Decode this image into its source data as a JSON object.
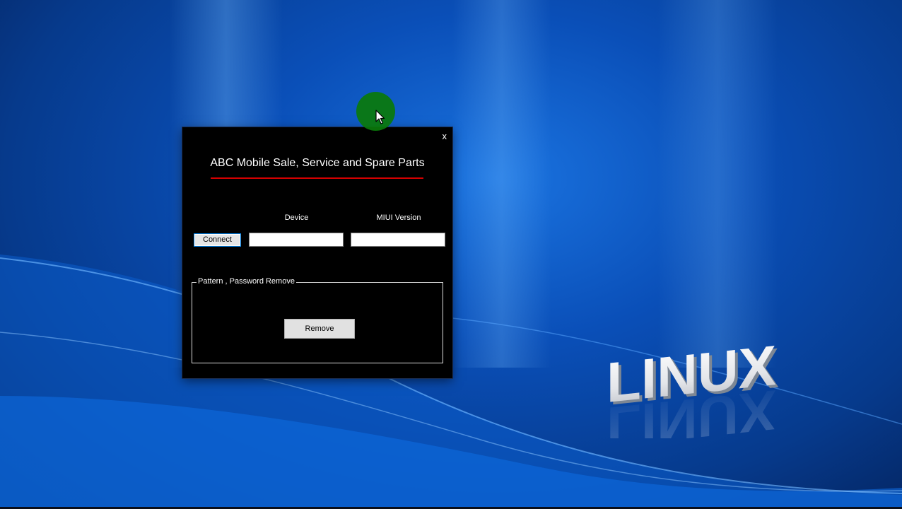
{
  "desktop": {
    "logo_text": "LINUX",
    "background_color": "#0a4fb8"
  },
  "dialog": {
    "title": "ABC Mobile Sale, Service and Spare Parts",
    "close_label": "x",
    "accent_underline_color": "#d40000",
    "columns": {
      "device_label": "Device",
      "miui_label": "MIUI Version"
    },
    "connect_label": "Connect",
    "device_value": "",
    "miui_value": "",
    "group": {
      "label": "Pattern , Password Remove",
      "remove_label": "Remove"
    }
  },
  "pointer": {
    "icon": "mouse-pointer-icon",
    "halo_color": "#0a7a0a"
  }
}
